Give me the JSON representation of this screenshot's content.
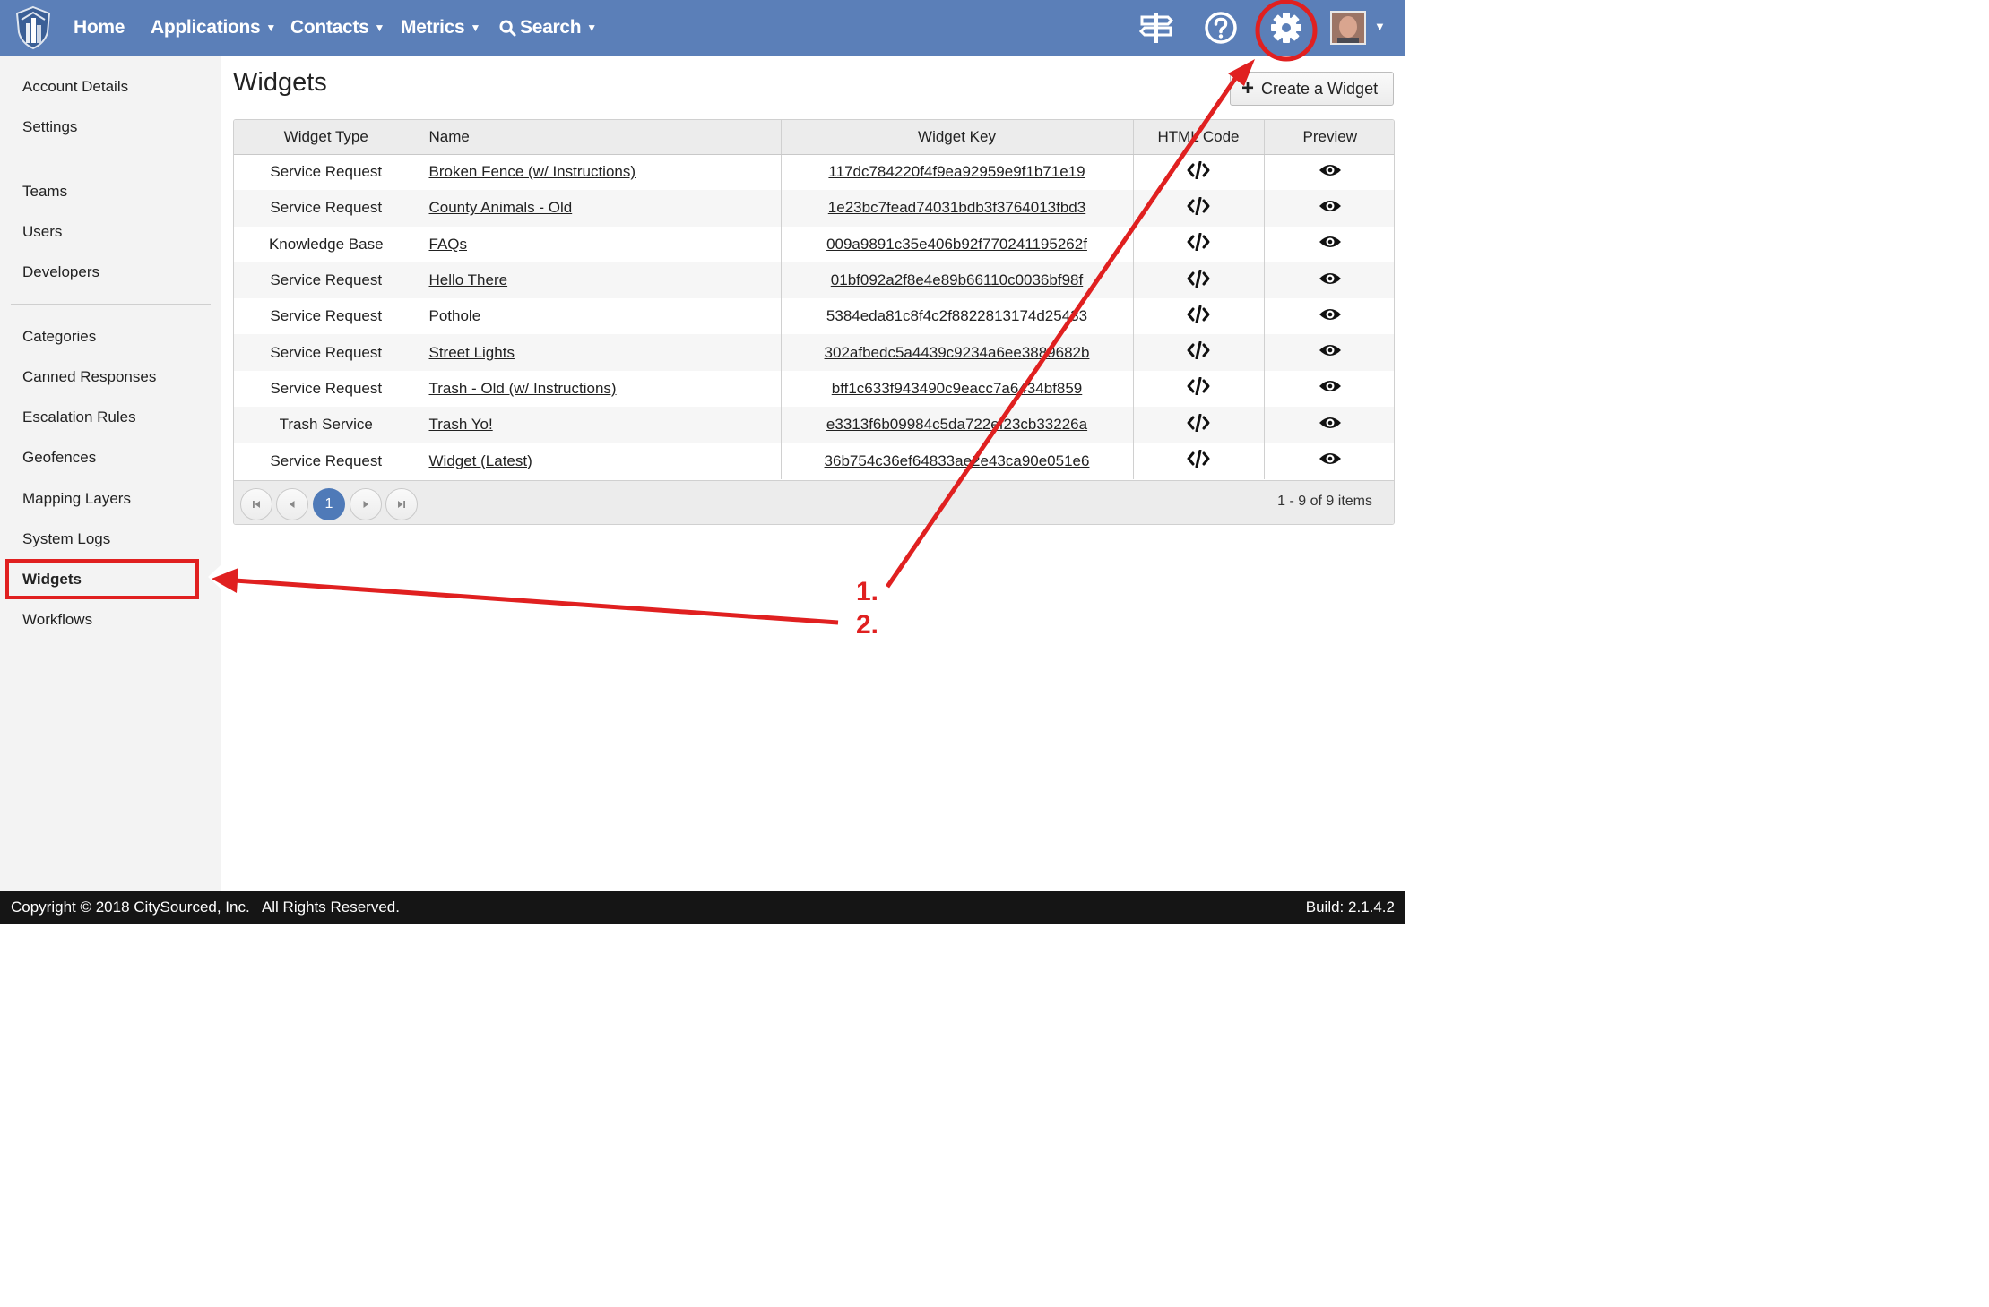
{
  "nav": {
    "home": "Home",
    "applications": "Applications",
    "contacts": "Contacts",
    "metrics": "Metrics",
    "search": "Search"
  },
  "sidebar": {
    "items": [
      "Account Details",
      "Settings",
      "Teams",
      "Users",
      "Developers",
      "Categories",
      "Canned Responses",
      "Escalation Rules",
      "Geofences",
      "Mapping Layers",
      "System Logs",
      "Widgets",
      "Workflows"
    ],
    "active": "Widgets"
  },
  "main": {
    "title": "Widgets",
    "create_button": "Create a Widget",
    "columns": [
      "Widget Type",
      "Name",
      "Widget Key",
      "HTML Code",
      "Preview"
    ],
    "rows": [
      {
        "type": "Service Request",
        "name": "Broken Fence (w/ Instructions)",
        "key": "117dc784220f4f9ea92959e9f1b71e19"
      },
      {
        "type": "Service Request",
        "name": "County Animals - Old",
        "key": "1e23bc7fead74031bdb3f3764013fbd3"
      },
      {
        "type": "Knowledge Base",
        "name": "FAQs",
        "key": "009a9891c35e406b92f770241195262f"
      },
      {
        "type": "Service Request",
        "name": "Hello There",
        "key": "01bf092a2f8e4e89b66110c0036bf98f"
      },
      {
        "type": "Service Request",
        "name": "Pothole",
        "key": "5384eda81c8f4c2f8822813174d25433"
      },
      {
        "type": "Service Request",
        "name": "Street Lights",
        "key": "302afbedc5a4439c9234a6ee3889682b"
      },
      {
        "type": "Service Request",
        "name": "Trash - Old (w/ Instructions)",
        "key": "bff1c633f943490c9eacc7a6434bf859"
      },
      {
        "type": "Trash Service",
        "name": "Trash Yo!",
        "key": "e3313f6b09984c5da722ef23cb33226a"
      },
      {
        "type": "Service Request",
        "name": "Widget (Latest)",
        "key": "36b754c36ef64833ae2e43ca90e051e6"
      }
    ],
    "pager": {
      "current_page": "1",
      "info": "1 - 9 of 9 items"
    }
  },
  "footer": {
    "copyright": "Copyright © 2018 CitySourced, Inc.   All Rights Reserved.",
    "build": "Build: 2.1.4.2"
  },
  "annotations": {
    "step1": "1.",
    "step2": "2."
  },
  "colors": {
    "topbar": "#5b7fb8",
    "accent": "#4f7ab8",
    "annotation": "#e02020",
    "footer": "#151515"
  }
}
